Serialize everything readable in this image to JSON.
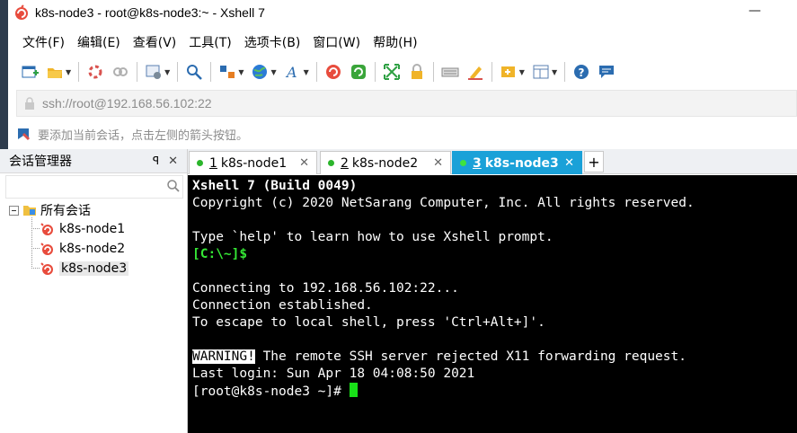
{
  "window": {
    "title": "k8s-node3 - root@k8s-node3:~ - Xshell 7",
    "minimize": "—"
  },
  "menu": [
    "文件(F)",
    "编辑(E)",
    "查看(V)",
    "工具(T)",
    "选项卡(B)",
    "窗口(W)",
    "帮助(H)"
  ],
  "address": {
    "url": "ssh://root@192.168.56.102:22"
  },
  "hint": {
    "text": "要添加当前会话，点击左侧的箭头按钮。"
  },
  "session_manager": {
    "title": "会话管理器",
    "pin": "ꟼ",
    "close": "✕",
    "root": "所有会话",
    "items": [
      "k8s-node1",
      "k8s-node2",
      "k8s-node3"
    ]
  },
  "tabs": [
    {
      "num": "1",
      "name": "k8s-node1",
      "close": "✕"
    },
    {
      "num": "2",
      "name": "k8s-node2",
      "close": "✕"
    },
    {
      "num": "3",
      "name": "k8s-node3",
      "close": "✕"
    }
  ],
  "tab_add": "+",
  "terminal": {
    "line1": "Xshell 7 (Build 0049)",
    "line2": "Copyright (c) 2020 NetSarang Computer, Inc. All rights reserved.",
    "line3": "Type `help' to learn how to use Xshell prompt.",
    "line4": "[C:\\~]$",
    "line5": "Connecting to 192.168.56.102:22...",
    "line6": "Connection established.",
    "line7": "To escape to local shell, press 'Ctrl+Alt+]'.",
    "warning_tag": "WARNING!",
    "line8_rest": " The remote SSH server rejected X11 forwarding request.",
    "line9": "Last login: Sun Apr 18 04:08:50 2021",
    "line10": "[root@k8s-node3 ~]# "
  },
  "colors": {
    "active_tab": "#1aa1d8",
    "prompt_green": "#35e635",
    "cursor": "#18e018",
    "terminal_bg": "#000000"
  }
}
